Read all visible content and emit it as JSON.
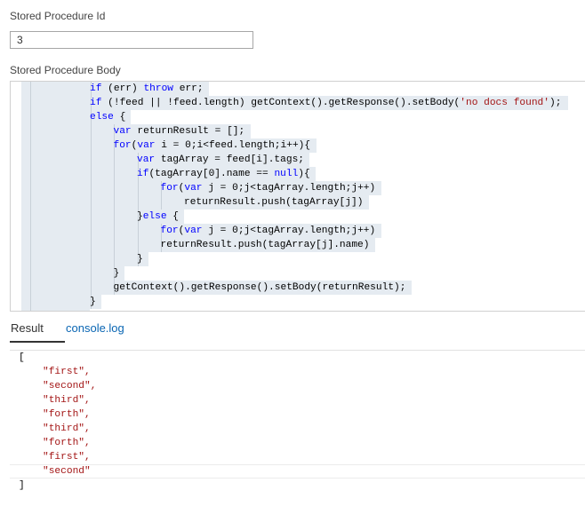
{
  "form": {
    "id_label": "Stored Procedure Id",
    "id_value": "3",
    "body_label": "Stored Procedure Body"
  },
  "editor": {
    "lines": [
      [
        {
          "t": "if",
          "c": "kw"
        },
        {
          "t": " (err) "
        },
        {
          "t": "throw",
          "c": "kw"
        },
        {
          "t": " err;"
        }
      ],
      [
        {
          "t": "if",
          "c": "kw"
        },
        {
          "t": " (!feed || !feed.length) getContext().getResponse().setBody("
        },
        {
          "t": "'no docs found'",
          "c": "str"
        },
        {
          "t": ");"
        }
      ],
      [
        {
          "t": "else",
          "c": "kw"
        },
        {
          "t": " {"
        }
      ],
      [
        {
          "t": "var",
          "c": "kw"
        },
        {
          "t": " returnResult = [];"
        }
      ],
      [
        {
          "t": "for",
          "c": "kw"
        },
        {
          "t": "("
        },
        {
          "t": "var",
          "c": "kw"
        },
        {
          "t": " i = 0;i<feed.length;i++){"
        }
      ],
      [
        {
          "t": "var",
          "c": "kw"
        },
        {
          "t": " tagArray = feed[i].tags;"
        }
      ],
      [
        {
          "t": "if",
          "c": "kw"
        },
        {
          "t": "(tagArray[0].name == "
        },
        {
          "t": "null",
          "c": "kw"
        },
        {
          "t": "){"
        }
      ],
      [
        {
          "t": "for",
          "c": "kw"
        },
        {
          "t": "("
        },
        {
          "t": "var",
          "c": "kw"
        },
        {
          "t": " j = 0;j<tagArray.length;j++)"
        }
      ],
      [
        {
          "t": "returnResult.push(tagArray[j])"
        }
      ],
      [
        {
          "t": "}"
        },
        {
          "t": "else",
          "c": "kw"
        },
        {
          "t": " {"
        }
      ],
      [
        {
          "t": "for",
          "c": "kw"
        },
        {
          "t": "("
        },
        {
          "t": "var",
          "c": "kw"
        },
        {
          "t": " j = 0;j<tagArray.length;j++)"
        }
      ],
      [
        {
          "t": "returnResult.push(tagArray[j].name)"
        }
      ],
      [
        {
          "t": "}"
        }
      ],
      [
        {
          "t": "}"
        }
      ],
      [
        {
          "t": "getContext().getResponse().setBody(returnResult);"
        }
      ],
      [
        {
          "t": "}"
        }
      ],
      [
        {
          "t": "});"
        }
      ]
    ]
  },
  "tabs": {
    "result_label": "Result",
    "console_label": "console.log"
  },
  "output": {
    "open_bracket": "[",
    "items": [
      "\"first\",",
      "\"second\",",
      "\"third\",",
      "\"forth\",",
      "\"third\",",
      "\"forth\",",
      "\"first\",",
      "\"second\""
    ],
    "close_bracket": "]"
  }
}
